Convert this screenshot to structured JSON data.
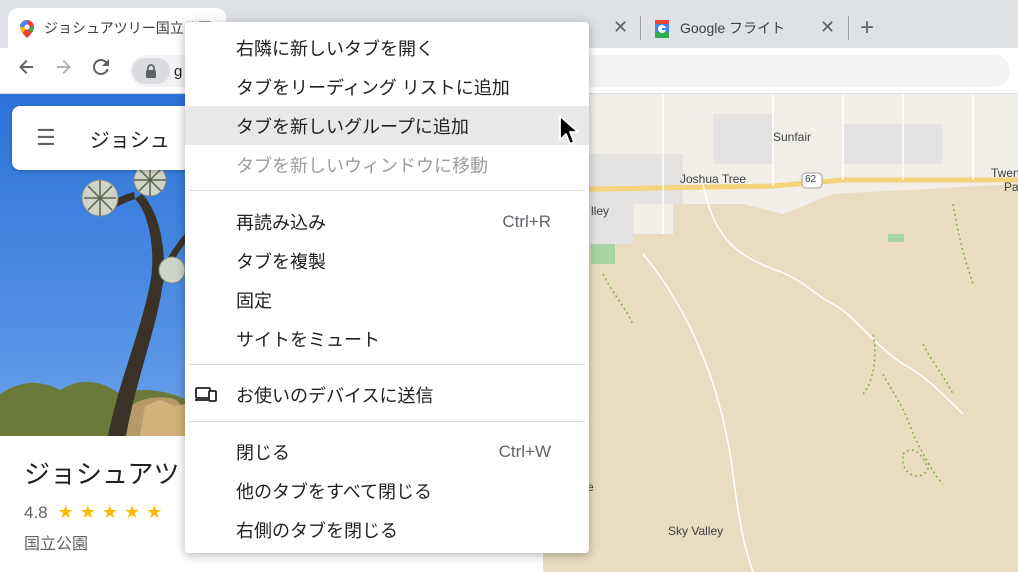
{
  "tabs": [
    {
      "title": "ジョシュアツリー国立公園",
      "active": true,
      "icon": "google-maps-pin-icon"
    },
    {
      "title": "",
      "active": false,
      "icon": ""
    },
    {
      "title": "Google フライト",
      "active": false,
      "icon": "google-flights-icon"
    }
  ],
  "toolbar": {
    "back_icon": "back-arrow-icon",
    "forward_icon": "forward-arrow-icon",
    "reload_icon": "reload-icon",
    "url": "g"
  },
  "sidepanel": {
    "search_query": "ジョシュ",
    "place_title": "ジョシュアツ",
    "rating": "4.8",
    "category": "国立公園"
  },
  "map": {
    "labels": [
      "Sunfair",
      "Joshua Tree",
      "62",
      "Twen",
      "Pa",
      "lley",
      "Sky Valley",
      "e"
    ]
  },
  "context_menu": {
    "items": [
      {
        "label": "右隣に新しいタブを開く"
      },
      {
        "label": "タブをリーディング リストに追加"
      },
      {
        "label": "タブを新しいグループに追加",
        "highlighted": true
      },
      {
        "label": "タブを新しいウィンドウに移動",
        "disabled": true
      },
      {
        "label": "再読み込み",
        "shortcut": "Ctrl+R"
      },
      {
        "label": "タブを複製"
      },
      {
        "label": "固定"
      },
      {
        "label": "サイトをミュート"
      },
      {
        "label": "お使いのデバイスに送信",
        "icon": "send-to-devices-icon"
      },
      {
        "label": "閉じる",
        "shortcut": "Ctrl+W"
      },
      {
        "label": "他のタブをすべて閉じる"
      },
      {
        "label": "右側のタブを閉じる"
      }
    ]
  },
  "colors": {
    "tabstrip": "#dee1e6",
    "star": "#fbbc04",
    "highway": "#f6d27a",
    "map_land": "#e9dcc0"
  }
}
